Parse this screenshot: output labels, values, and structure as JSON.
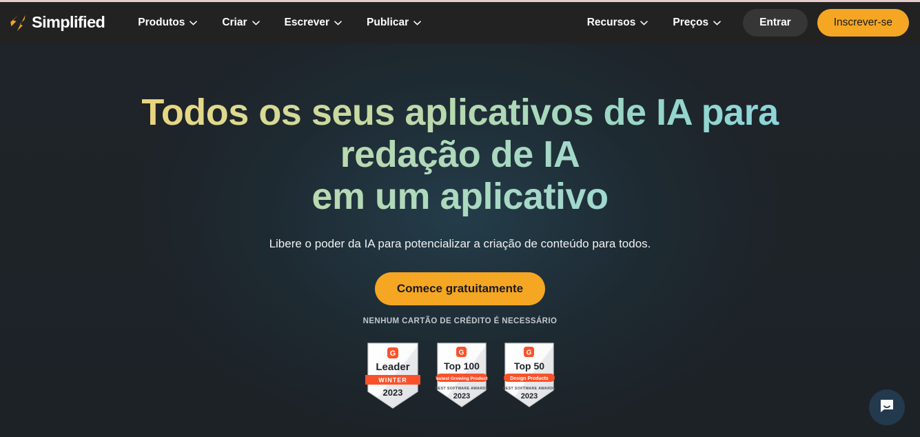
{
  "brand": {
    "name": "Simplified",
    "logo_icon": "simplified-lightning-logo",
    "logo_color": "#f5a623"
  },
  "nav": {
    "left_items": [
      {
        "label": "Produtos",
        "icon": "chevron-down-icon"
      },
      {
        "label": "Criar",
        "icon": "chevron-down-icon"
      },
      {
        "label": "Escrever",
        "icon": "chevron-down-icon"
      },
      {
        "label": "Publicar",
        "icon": "chevron-down-icon"
      }
    ],
    "right_items": [
      {
        "label": "Recursos",
        "icon": "chevron-down-icon"
      },
      {
        "label": "Preços",
        "icon": "chevron-down-icon"
      }
    ],
    "signin_label": "Entrar",
    "signup_label": "Inscrever-se",
    "signup_color": "#f5a623",
    "signin_color": "#363636",
    "background": "#222222"
  },
  "hero": {
    "headline_line1": "Todos os seus aplicativos de IA para",
    "headline_line2": "redação de IA",
    "headline_line3": "em um aplicativo",
    "subheadline": "Libere o poder da IA para potencializar a criação de conteúdo para todos.",
    "cta_label": "Comece gratuitamente",
    "cta_color": "#f5a623",
    "no_card_text": "NENHUM CARTÃO DE CRÉDITO É NECESSÁRIO",
    "gradient_start": "#f2c75c",
    "gradient_end": "#7fd4ef",
    "background_color": "#1d2227"
  },
  "badges": [
    {
      "name": "g2-leader-winter-2023-badge",
      "logo": "g2-logo",
      "title": "Leader",
      "ribbon": "WINTER",
      "subtitle": "",
      "year": "2023",
      "ribbon_color": "#f9522a"
    },
    {
      "name": "g2-top-100-fastest-growing-badge",
      "logo": "g2-logo",
      "title": "Top 100",
      "ribbon": "Fastest Growing Products",
      "subtitle": "BEST SOFTWARE AWARDS",
      "year": "2023",
      "ribbon_color": "#f9522a"
    },
    {
      "name": "g2-top-50-design-products-badge",
      "logo": "g2-logo",
      "title": "Top 50",
      "ribbon": "Design Products",
      "subtitle": "BEST SOFTWARE AWARDS",
      "year": "2023",
      "ribbon_color": "#f9522a"
    }
  ],
  "chat": {
    "icon": "chat-bubble-smile-icon",
    "color": "#23394d"
  }
}
